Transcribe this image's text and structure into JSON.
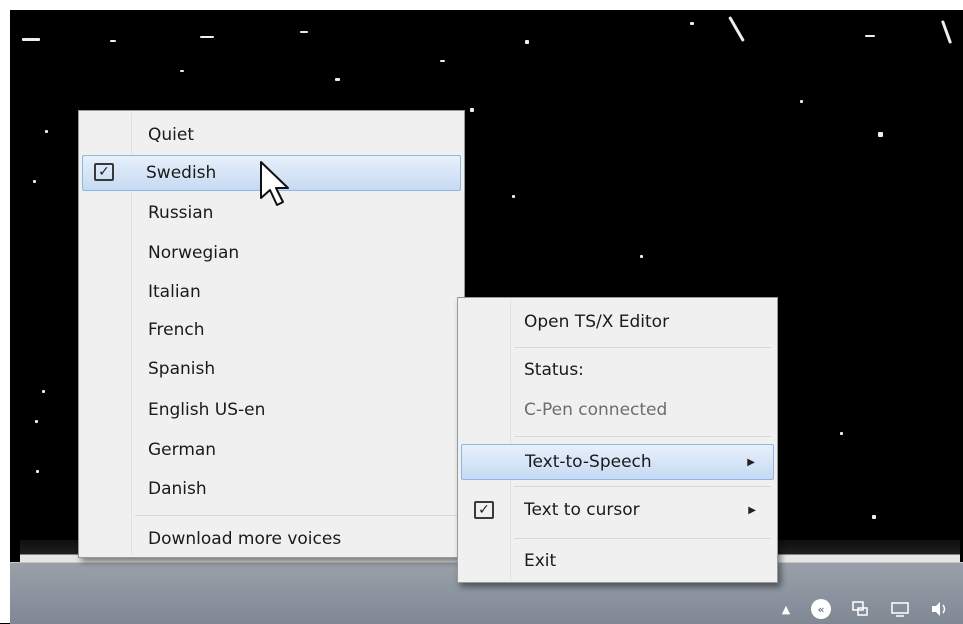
{
  "voice_menu": {
    "items": [
      {
        "label": "Quiet"
      },
      {
        "label": "Swedish",
        "checked": true,
        "highlighted": true
      },
      {
        "label": "Russian"
      },
      {
        "label": "Norwegian"
      },
      {
        "label": "Italian"
      },
      {
        "label": "French"
      },
      {
        "label": "Spanish"
      },
      {
        "label": "English US-en"
      },
      {
        "label": "German"
      },
      {
        "label": "Danish"
      }
    ],
    "download_label": "Download more voices"
  },
  "context_menu": {
    "open_editor": "Open TS/X Editor",
    "status_label": "Status:",
    "status_value": "C-Pen connected",
    "text_to_speech": "Text-to-Speech",
    "text_to_cursor": "Text to cursor",
    "exit": "Exit"
  },
  "tray": {
    "icons": [
      "show-hidden-icons-arrow",
      "c-pen-icon",
      "network-icon",
      "action-center-icon",
      "volume-icon"
    ]
  },
  "colors": {
    "highlight_bg": "#c5daf3",
    "highlight_border": "#8fb5e2",
    "taskbar": "#8a929c"
  }
}
